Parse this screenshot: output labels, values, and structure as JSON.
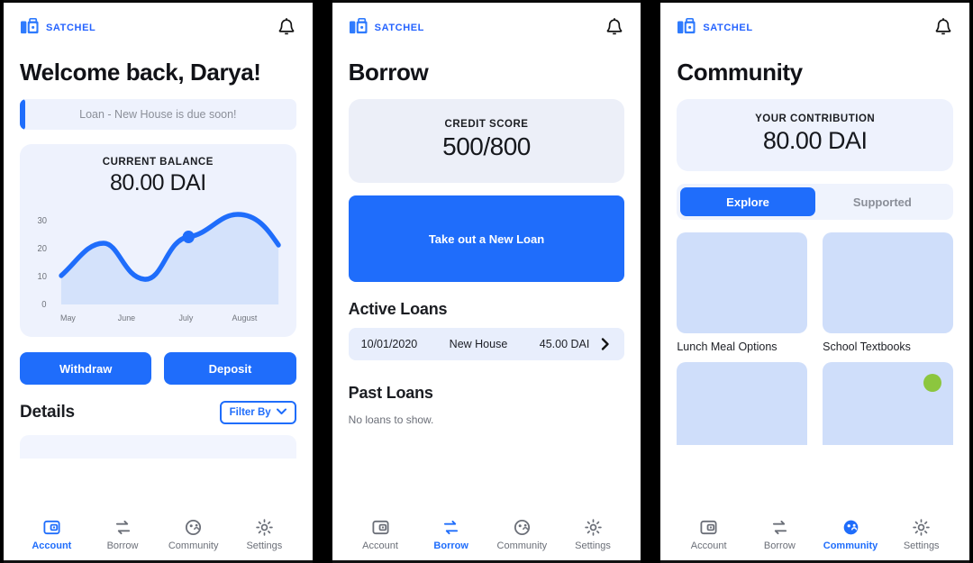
{
  "theme": {
    "accent": "#1f6dfb",
    "card_bg": "#eef2fd",
    "thumb_bg": "#cfdefa",
    "dot_green": "#8cc63e",
    "muted_text": "#6b6f78"
  },
  "brand": {
    "name": "SATCHEL",
    "logo_icon": "briefcase-icon"
  },
  "notification_icon": "bell-icon",
  "screens": [
    {
      "id": "account",
      "title": "Welcome back, Darya!",
      "alert": {
        "text": "Loan - New House is due soon!"
      },
      "balance_card": {
        "label": "CURRENT BALANCE",
        "value": "80.00 DAI"
      },
      "buttons": {
        "withdraw": "Withdraw",
        "deposit": "Deposit"
      },
      "details": {
        "title": "Details",
        "filter_label": "Filter By",
        "filter_icon": "chevron-down-icon"
      },
      "nav_active": "Account"
    },
    {
      "id": "borrow",
      "title": "Borrow",
      "credit_card": {
        "label": "CREDIT SCORE",
        "value": "500/800"
      },
      "cta": "Take out a New Loan",
      "active_loans": {
        "title": "Active Loans",
        "rows": [
          {
            "date": "10/01/2020",
            "name": "New House",
            "amount": "45.00 DAI",
            "chevron_icon": "chevron-right-icon"
          }
        ]
      },
      "past_loans": {
        "title": "Past Loans",
        "empty": "No loans to show."
      },
      "nav_active": "Borrow"
    },
    {
      "id": "community",
      "title": "Community",
      "contribution_card": {
        "label": "YOUR CONTRIBUTION",
        "value": "80.00 DAI"
      },
      "segments": [
        {
          "label": "Explore",
          "active": true
        },
        {
          "label": "Supported",
          "active": false
        }
      ],
      "cards": [
        {
          "label": "Lunch Meal Options",
          "badge": false
        },
        {
          "label": "School Textbooks",
          "badge": false
        },
        {
          "label": "",
          "badge": false
        },
        {
          "label": "",
          "badge": true
        }
      ],
      "nav_active": "Community"
    }
  ],
  "nav": [
    {
      "label": "Account",
      "icon": "wallet-icon"
    },
    {
      "label": "Borrow",
      "icon": "swap-arrows-icon"
    },
    {
      "label": "Community",
      "icon": "globe-people-icon"
    },
    {
      "label": "Settings",
      "icon": "gear-icon"
    }
  ],
  "chart_data": {
    "type": "area",
    "title": "CURRENT BALANCE",
    "xlabel": "",
    "ylabel": "",
    "categories": [
      "May",
      "June",
      "July",
      "August"
    ],
    "x_tick_labels": [
      "May",
      "June",
      "July",
      "August"
    ],
    "y_tick_labels": [
      "0",
      "10",
      "20",
      "30"
    ],
    "ylim": [
      0,
      33
    ],
    "grid": false,
    "legend": "none",
    "line_color": "#1f6dfb",
    "fill_color": "#d4e2fb",
    "series": [
      {
        "name": "Balance",
        "x": [
          "May",
          "May-mid",
          "June",
          "June-mid",
          "July",
          "July-mid",
          "August"
        ],
        "values": [
          10,
          22,
          17,
          10,
          22,
          31,
          21
        ]
      }
    ],
    "markers": [
      {
        "x": "July",
        "y": 22
      }
    ]
  }
}
